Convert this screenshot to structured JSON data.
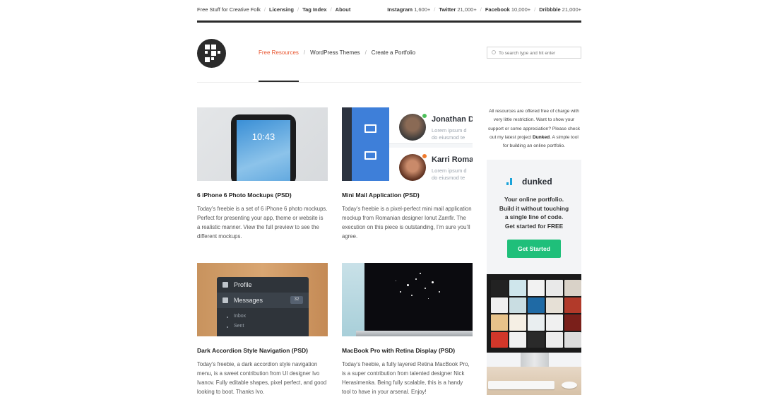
{
  "topbar": {
    "tagline": "Free Stuff for Creative Folk",
    "links": [
      "Licensing",
      "Tag Index",
      "About"
    ],
    "social": [
      {
        "name": "Instagram",
        "count": "1,600+"
      },
      {
        "name": "Twitter",
        "count": "21,000+"
      },
      {
        "name": "Facebook",
        "count": "10,000+"
      },
      {
        "name": "Dribbble",
        "count": "21,000+"
      }
    ]
  },
  "nav": {
    "items": [
      "Free Resources",
      "WordPress Themes",
      "Create a Portfolio"
    ],
    "active": "Free Resources"
  },
  "search": {
    "placeholder": "To search type and hit enter"
  },
  "cards": [
    {
      "title": "6 iPhone 6 Photo Mockups (PSD)",
      "text": "Today’s freebie is a set of 6 iPhone 6 photo mockups. Perfect for presenting your app, theme or website is a realistic manner. View the full preview to see the different mockups.",
      "thumb_text": "10:43"
    },
    {
      "title": "Mini Mail Application (PSD)",
      "text": "Today’s freebie is a pixel-perfect mini mail application mockup from Romanian designer Ionut Zamfir. The execution on this piece is outstanding, I’m sure you’ll agree.",
      "contacts": [
        {
          "name": "Jonathan D",
          "sub1": "Lorem ipsum d",
          "sub2": "do eiusmod te",
          "status_color": "#4cc05a"
        },
        {
          "name": "Karri Roma",
          "sub1": "Lorem ipsum d",
          "sub2": "do eiusmod te",
          "status_color": "#f07a2c"
        }
      ]
    },
    {
      "title": "Dark Accordion Style Navigation (PSD)",
      "text": "Today’s freebie, a dark accordion style navigation menu, is a sweet contribution from UI designer Ivo Ivanov. Fully editable shapes, pixel perfect, and good looking to boot. Thanks Ivo.",
      "menu": {
        "profile": "Profile",
        "messages": "Messages",
        "badge": "32",
        "sub": [
          "Inbox",
          "Sent"
        ]
      }
    },
    {
      "title": "MacBook Pro with Retina Display (PSD)",
      "text": "Today’s freebie, a fully layered Retina MacBook Pro, is a super contribution from talented designer Nick Herasimenka. Being fully scalable, this is a handy tool to have in your arsenal. Enjoy!"
    }
  ],
  "sidebar": {
    "intro_pre": "All resources are offered free of charge with very little restriction. Want to show your support or some appreciation? Please check out my latest project ",
    "intro_bold": "Dunked",
    "intro_post": ". A simple tool for building an online portfolio.",
    "ad": {
      "brand": "dunked",
      "tagline": [
        "Your online portfolio.",
        "Build it without touching",
        "a single line of code.",
        "Get started for FREE"
      ],
      "button": "Get Started"
    }
  },
  "colors": {
    "accent": "#e8552f",
    "dark": "#2b2b2b",
    "green": "#1fbf7a",
    "brand_blue": "#1aa3d9"
  }
}
